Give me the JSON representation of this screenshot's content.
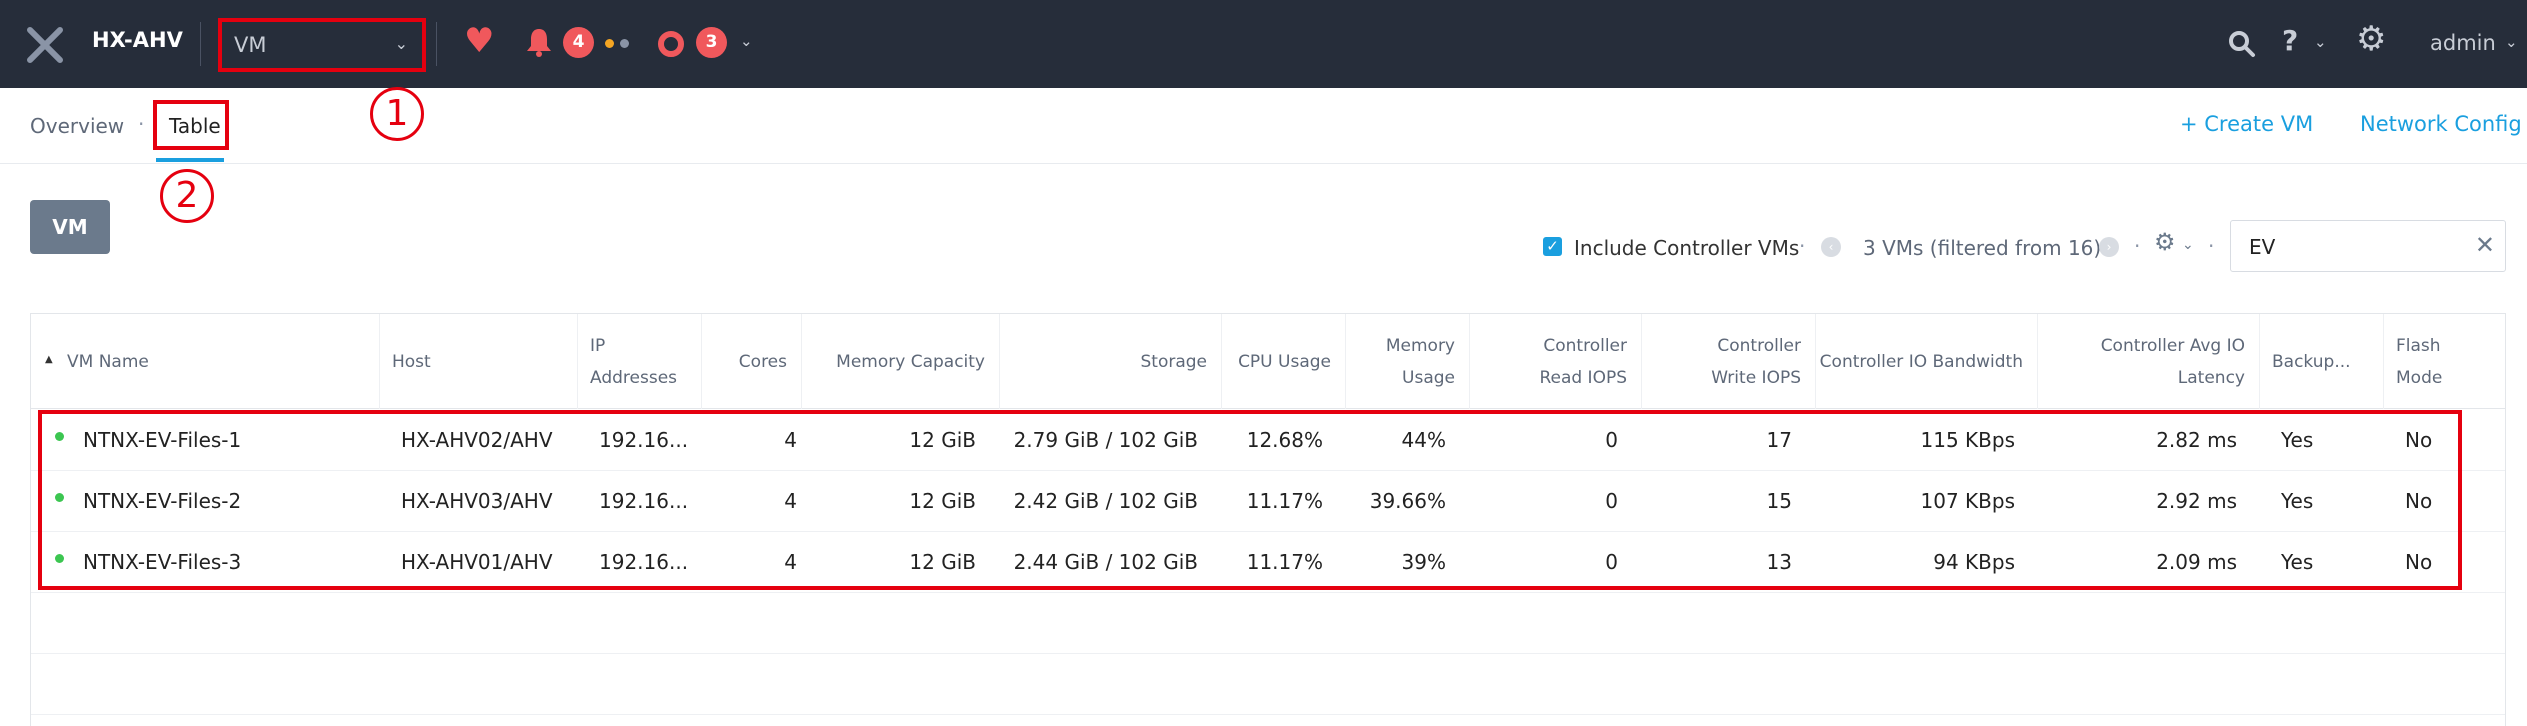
{
  "topbar": {
    "cluster_name": "HX-AHV",
    "entity_selector": "VM",
    "alerts_count": "4",
    "tasks_count": "3",
    "user": "admin"
  },
  "subnav": {
    "tab_overview": "Overview",
    "tab_separator": "·",
    "tab_table": "Table",
    "create_vm": "+ Create VM",
    "network_config": "Network Config"
  },
  "callouts": {
    "one": "1",
    "two": "2"
  },
  "toolbar": {
    "vm_button": "VM",
    "include_controller_label": "Include Controller VMs",
    "include_controller_checked": true,
    "separator": "·",
    "filter_count": "3 VMs (filtered from 16)",
    "search_value": "EV"
  },
  "table": {
    "columns": [
      "VM Name",
      "Host",
      "IP Addresses",
      "Cores",
      "Memory Capacity",
      "Storage",
      "CPU Usage",
      "Memory Usage",
      "Controller Read IOPS",
      "Controller Write IOPS",
      "Controller IO Bandwidth",
      "Controller Avg IO Latency",
      "Backup...",
      "Flash Mode"
    ],
    "rows": [
      [
        "NTNX-EV-Files-1",
        "HX-AHV02/AHV",
        "192.16...",
        "4",
        "12 GiB",
        "2.79 GiB / 102 GiB",
        "12.68%",
        "44%",
        "0",
        "17",
        "115 KBps",
        "2.82 ms",
        "Yes",
        "No"
      ],
      [
        "NTNX-EV-Files-2",
        "HX-AHV03/AHV",
        "192.16...",
        "4",
        "12 GiB",
        "2.42 GiB / 102 GiB",
        "11.17%",
        "39.66%",
        "0",
        "15",
        "107 KBps",
        "2.92 ms",
        "Yes",
        "No"
      ],
      [
        "NTNX-EV-Files-3",
        "HX-AHV01/AHV",
        "192.16...",
        "4",
        "12 GiB",
        "2.44 GiB / 102 GiB",
        "11.17%",
        "39%",
        "0",
        "13",
        "94 KBps",
        "2.09 ms",
        "Yes",
        "No"
      ]
    ]
  },
  "colors": {
    "topbar_bg": "#262d3a",
    "accent": "#1a9fdf",
    "alert_red": "#f0585c",
    "annotation_red": "#e5000f",
    "status_green": "#3cc651"
  }
}
